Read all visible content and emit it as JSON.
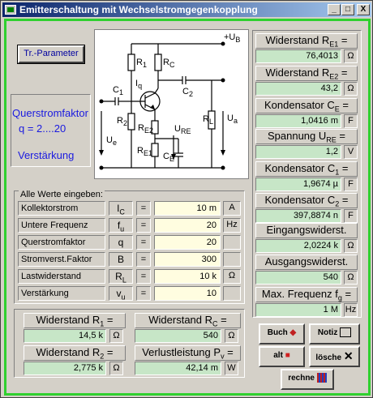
{
  "window": {
    "title": "Emitterschaltung mit Wechselstromgegenkopplung",
    "min": "_",
    "max": "□",
    "close": "X"
  },
  "buttons": {
    "tr_param": "Tr.-Parameter",
    "buch": "Buch",
    "notiz": "Notiz",
    "alt": "alt",
    "loesche": "lösche",
    "rechne": "rechne"
  },
  "info": {
    "line1": "Querstromfaktor",
    "line2": "q = 2....20",
    "line3": "Verstärkung"
  },
  "schematic": {
    "ub": "+U",
    "ub_sub": "B",
    "r1": "R",
    "r1s": "1",
    "rc": "R",
    "rcs": "C",
    "iq": "I",
    "iqs": "q",
    "c1": "C",
    "c1s": "1",
    "c2": "C",
    "c2s": "2",
    "r2": "R",
    "r2s": "2",
    "re2": "R",
    "re2s": "E2",
    "ure": "U",
    "ures": "RE",
    "rl": "R",
    "rls": "L",
    "ua": "U",
    "uas": "a",
    "ue": "U",
    "ues": "e",
    "re1": "R",
    "re1s": "E1",
    "ce": "C",
    "ces": "E"
  },
  "inputs": {
    "title": "Alle Werte eingeben:",
    "rows": [
      {
        "label": "Kollektorstrom",
        "sym": "I",
        "sub": "C",
        "value": "10 m",
        "unit": "A"
      },
      {
        "label": "Untere Frequenz",
        "sym": "f",
        "sub": "u",
        "value": "20",
        "unit": "Hz"
      },
      {
        "label": "Querstromfaktor",
        "sym": "q",
        "sub": "",
        "value": "20",
        "unit": ""
      },
      {
        "label": "Stromverst.Faktor",
        "sym": "B",
        "sub": "",
        "value": "300",
        "unit": ""
      },
      {
        "label": "Lastwiderstand",
        "sym": "R",
        "sub": "L",
        "value": "10 k",
        "unit": "Ω"
      },
      {
        "label": "Verstärkung",
        "sym": "v",
        "sub": "u",
        "value": "10",
        "unit": ""
      }
    ],
    "eq": "="
  },
  "right": [
    {
      "name": "Widerstand R",
      "sub": "E1",
      "eq": " =",
      "value": "76,4013",
      "unit": "Ω"
    },
    {
      "name": "Widerstand R",
      "sub": "E2",
      "eq": " =",
      "value": "43,2",
      "unit": "Ω"
    },
    {
      "name": "Kondensator C",
      "sub": "E",
      "eq": " =",
      "value": "1,0416 m",
      "unit": "F"
    },
    {
      "name": "Spannung  U",
      "sub": "RE",
      "eq": " =",
      "value": "1,2",
      "unit": "V"
    },
    {
      "name": "Kondensator C",
      "sub": "1",
      "eq": " =",
      "value": "1,9674 µ",
      "unit": "F"
    },
    {
      "name": "Kondensator C",
      "sub": "2",
      "eq": " =",
      "value": "397,8874 n",
      "unit": "F"
    },
    {
      "name": "Eingangswiderst.",
      "sub": "",
      "eq": "",
      "value": "2,0224 k",
      "unit": "Ω"
    },
    {
      "name": "Ausgangswiderst.",
      "sub": "",
      "eq": "",
      "value": "540",
      "unit": "Ω"
    },
    {
      "name": "Max. Frequenz f",
      "sub": "g",
      "eq": " =",
      "value": "1 M",
      "unit": "Hz"
    }
  ],
  "bottom": [
    {
      "name": "Widerstand R",
      "sub": "1",
      "eq": " =",
      "value": "14,5 k",
      "unit": "Ω"
    },
    {
      "name": "Widerstand R",
      "sub": "C",
      "eq": " =",
      "value": "540",
      "unit": "Ω"
    },
    {
      "name": "Widerstand R",
      "sub": "2",
      "eq": " =",
      "value": "2,775 k",
      "unit": "Ω"
    },
    {
      "name": "Verlustleistung P",
      "sub": "v",
      "eq": " =",
      "value": "42,14 m",
      "unit": "W"
    }
  ],
  "colors": {
    "accent": "#2fd02f",
    "info_text": "#1a1ae0",
    "result_bg": "#c7e6c7",
    "input_bg": "#fffde0"
  }
}
